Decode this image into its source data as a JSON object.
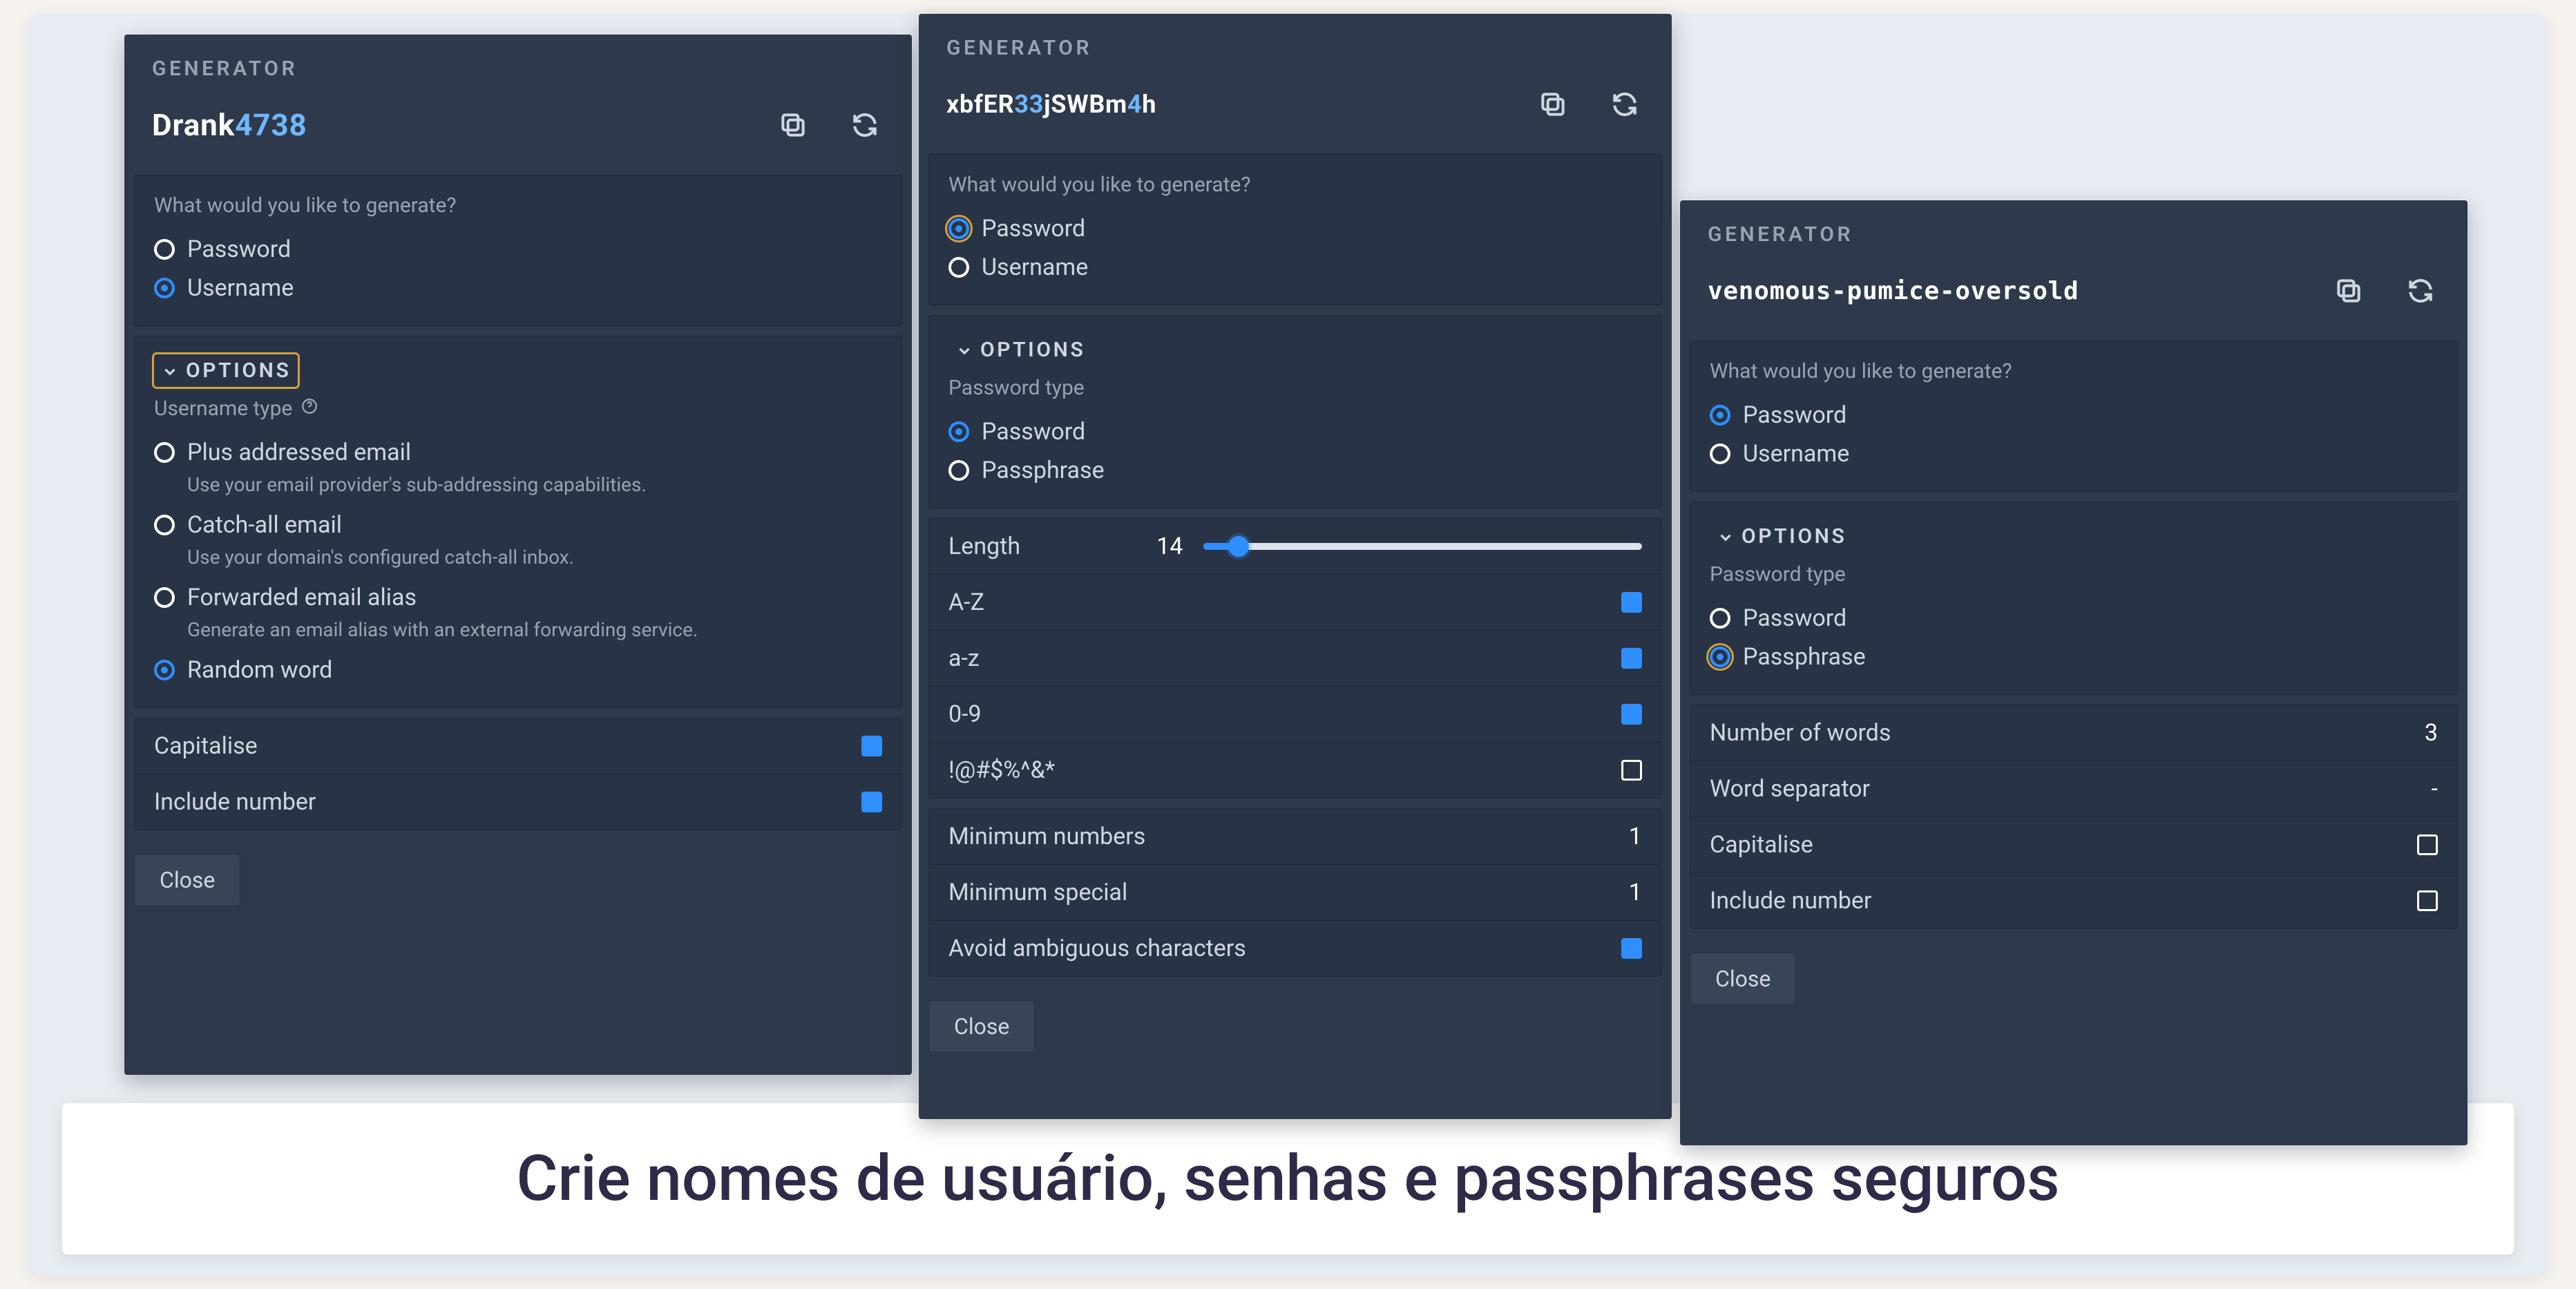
{
  "caption": "Crie nomes de usuário, senhas e passphrases seguros",
  "common": {
    "generator_title": "GENERATOR",
    "options_label": "OPTIONS",
    "close_label": "Close",
    "prompt": "What would you like to generate?",
    "radio_password": "Password",
    "radio_username": "Username",
    "password_type_label": "Password type",
    "pt_password": "Password",
    "pt_passphrase": "Passphrase"
  },
  "panel1": {
    "generated_prefix": "Drank",
    "generated_digits": "4738",
    "selected": "username",
    "username_type_label": "Username type",
    "opts": {
      "plus": {
        "title": "Plus addressed email",
        "desc": "Use your email provider's sub-addressing capabilities."
      },
      "catch": {
        "title": "Catch-all email",
        "desc": "Use your domain's configured catch-all inbox."
      },
      "fwd": {
        "title": "Forwarded email alias",
        "desc": "Generate an email alias with an external forwarding service."
      },
      "rnd": {
        "title": "Random word"
      }
    },
    "rows": {
      "cap": "Capitalise",
      "num": "Include number"
    }
  },
  "panel2": {
    "generated_a": "xbfER",
    "generated_d": "33",
    "generated_b": "jSWBm",
    "generated_d2": "4",
    "generated_c": "h",
    "length_label": "Length",
    "length_value": "14",
    "char_AZ": "A-Z",
    "char_az": "a-z",
    "char_09": "0-9",
    "char_sym": "!@#$%^&*",
    "min_numbers": "Minimum numbers",
    "min_numbers_v": "1",
    "min_special": "Minimum special",
    "min_special_v": "1",
    "avoid": "Avoid ambiguous characters"
  },
  "panel3": {
    "generated": "venomous-pumice-oversold",
    "num_words": "Number of words",
    "num_words_v": "3",
    "sep": "Word separator",
    "sep_v": "-",
    "cap": "Capitalise",
    "num": "Include number"
  }
}
